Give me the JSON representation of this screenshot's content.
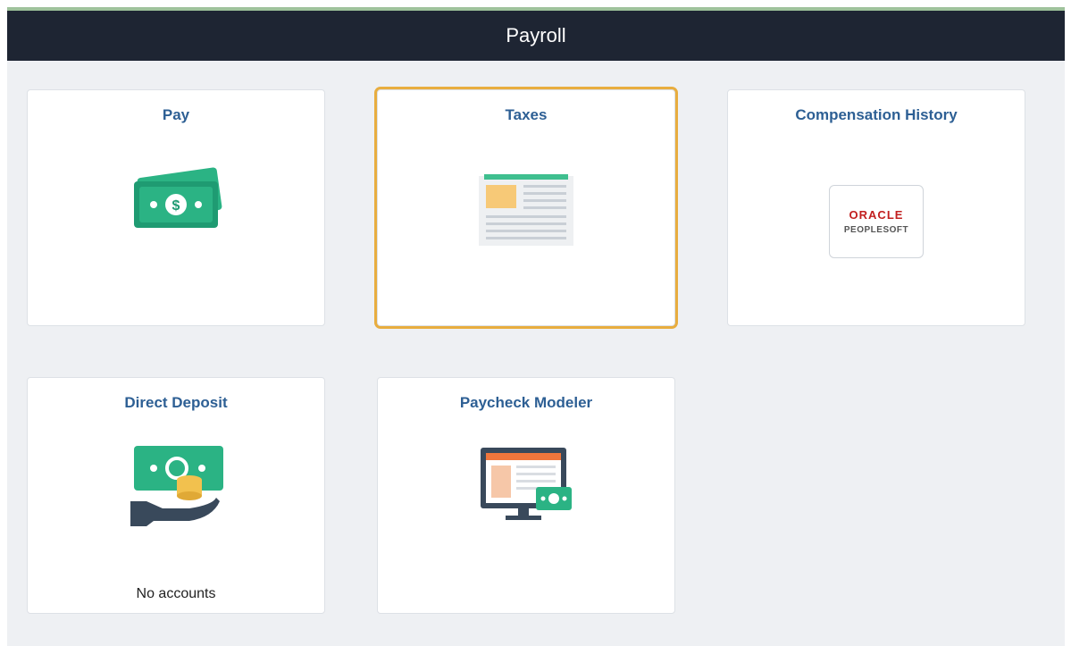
{
  "header": {
    "title": "Payroll"
  },
  "tiles": [
    {
      "title": "Pay",
      "icon": "money-icon"
    },
    {
      "title": "Taxes",
      "icon": "tax-form-icon",
      "selected": true
    },
    {
      "title": "Compensation History",
      "icon": "oracle-peoplesoft-logo"
    },
    {
      "title": "Direct Deposit",
      "icon": "direct-deposit-icon",
      "status": "No accounts"
    },
    {
      "title": "Paycheck Modeler",
      "icon": "paycheck-modeler-icon"
    }
  ],
  "logo": {
    "brand": "ORACLE",
    "product": "PEOPLESOFT"
  },
  "colors": {
    "header_bg": "#1e2533",
    "accent_green": "#2bb384",
    "tile_title": "#2d5f94",
    "selection": "#e8ad3f"
  }
}
